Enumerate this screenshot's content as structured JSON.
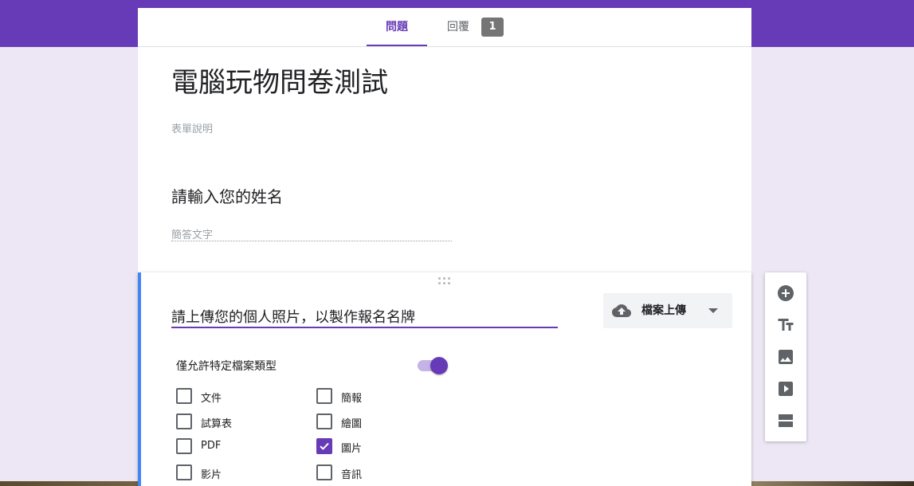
{
  "tabs": {
    "questions": "問題",
    "responses": "回覆",
    "responses_count": "1"
  },
  "form": {
    "title": "電腦玩物問卷測試",
    "description_placeholder": "表單說明"
  },
  "question1": {
    "title": "請輸入您的姓名",
    "answer_placeholder": "簡答文字"
  },
  "question2": {
    "title": "請上傳您的個人照片，以製作報名名牌",
    "type": {
      "label": "檔案上傳",
      "icon": "cloud-upload-icon"
    },
    "restrict_label": "僅允許特定檔案類型",
    "restrict_enabled": true,
    "file_types": [
      {
        "label": "文件",
        "checked": false
      },
      {
        "label": "簡報",
        "checked": false
      },
      {
        "label": "試算表",
        "checked": false
      },
      {
        "label": "繪圖",
        "checked": false
      },
      {
        "label": "PDF",
        "checked": false
      },
      {
        "label": "圖片",
        "checked": true
      },
      {
        "label": "影片",
        "checked": false
      },
      {
        "label": "音訊",
        "checked": false
      }
    ]
  },
  "toolbar": {
    "items": [
      "add-question-icon",
      "add-title-icon",
      "add-image-icon",
      "add-video-icon",
      "add-section-icon"
    ]
  },
  "colors": {
    "accent": "#673ab7",
    "background": "#ece6f5",
    "active_card": "#4285f4"
  }
}
